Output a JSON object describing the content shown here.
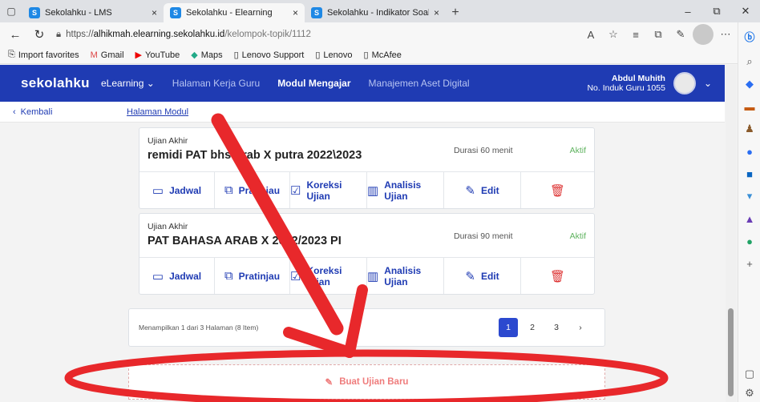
{
  "browser": {
    "tabs": [
      {
        "title": "Sekolahku - LMS",
        "active": false
      },
      {
        "title": "Sekolahku - Elearning",
        "active": true
      },
      {
        "title": "Sekolahku - Indikator Soal",
        "active": false
      }
    ],
    "url_scheme": "https://",
    "url_host": "alhikmah.elearning.sekolahku.id",
    "url_path": "/kelompok-topik/1112",
    "bookmarks": [
      "Import favorites",
      "Gmail",
      "YouTube",
      "Maps",
      "Lenovo Support",
      "Lenovo",
      "McAfee"
    ]
  },
  "app": {
    "brand": "sekolahku",
    "nav": {
      "elearning": "eLearning",
      "halaman_kerja_guru": "Halaman Kerja Guru",
      "modul_mengajar": "Modul Mengajar",
      "manajemen_aset": "Manajemen Aset Digital"
    },
    "user": {
      "name": "Abdul Muhith",
      "id_line": "No. Induk Guru 1055"
    }
  },
  "breadcrumb": {
    "back": "Kembali",
    "page": "Halaman Modul"
  },
  "exams": [
    {
      "type": "Ujian Akhir",
      "title": "remidi PAT bhs Arab X putra 2022\\2023",
      "duration": "Durasi 60 menit",
      "status": "Aktif"
    },
    {
      "type": "Ujian Akhir",
      "title": "PAT BAHASA ARAB X 2022/2023 PI",
      "duration": "Durasi 90 menit",
      "status": "Aktif"
    }
  ],
  "actions": {
    "jadwal": "Jadwal",
    "pratinjau": "Pratinjau",
    "koreksi": "Koreksi Ujian",
    "analisis": "Analisis Ujian",
    "edit": "Edit"
  },
  "pagination": {
    "info": "Menampilkan 1 dari 3 Halaman (8 Item)",
    "pages": [
      "1",
      "2",
      "3"
    ],
    "current": "1",
    "next": "›"
  },
  "add_exam": "Buat Ujian Baru",
  "colors": {
    "brand": "#1f3bb3",
    "active_status": "#5fb35f",
    "annotation": "#e8282b",
    "add_button": "#ef7c7c"
  }
}
